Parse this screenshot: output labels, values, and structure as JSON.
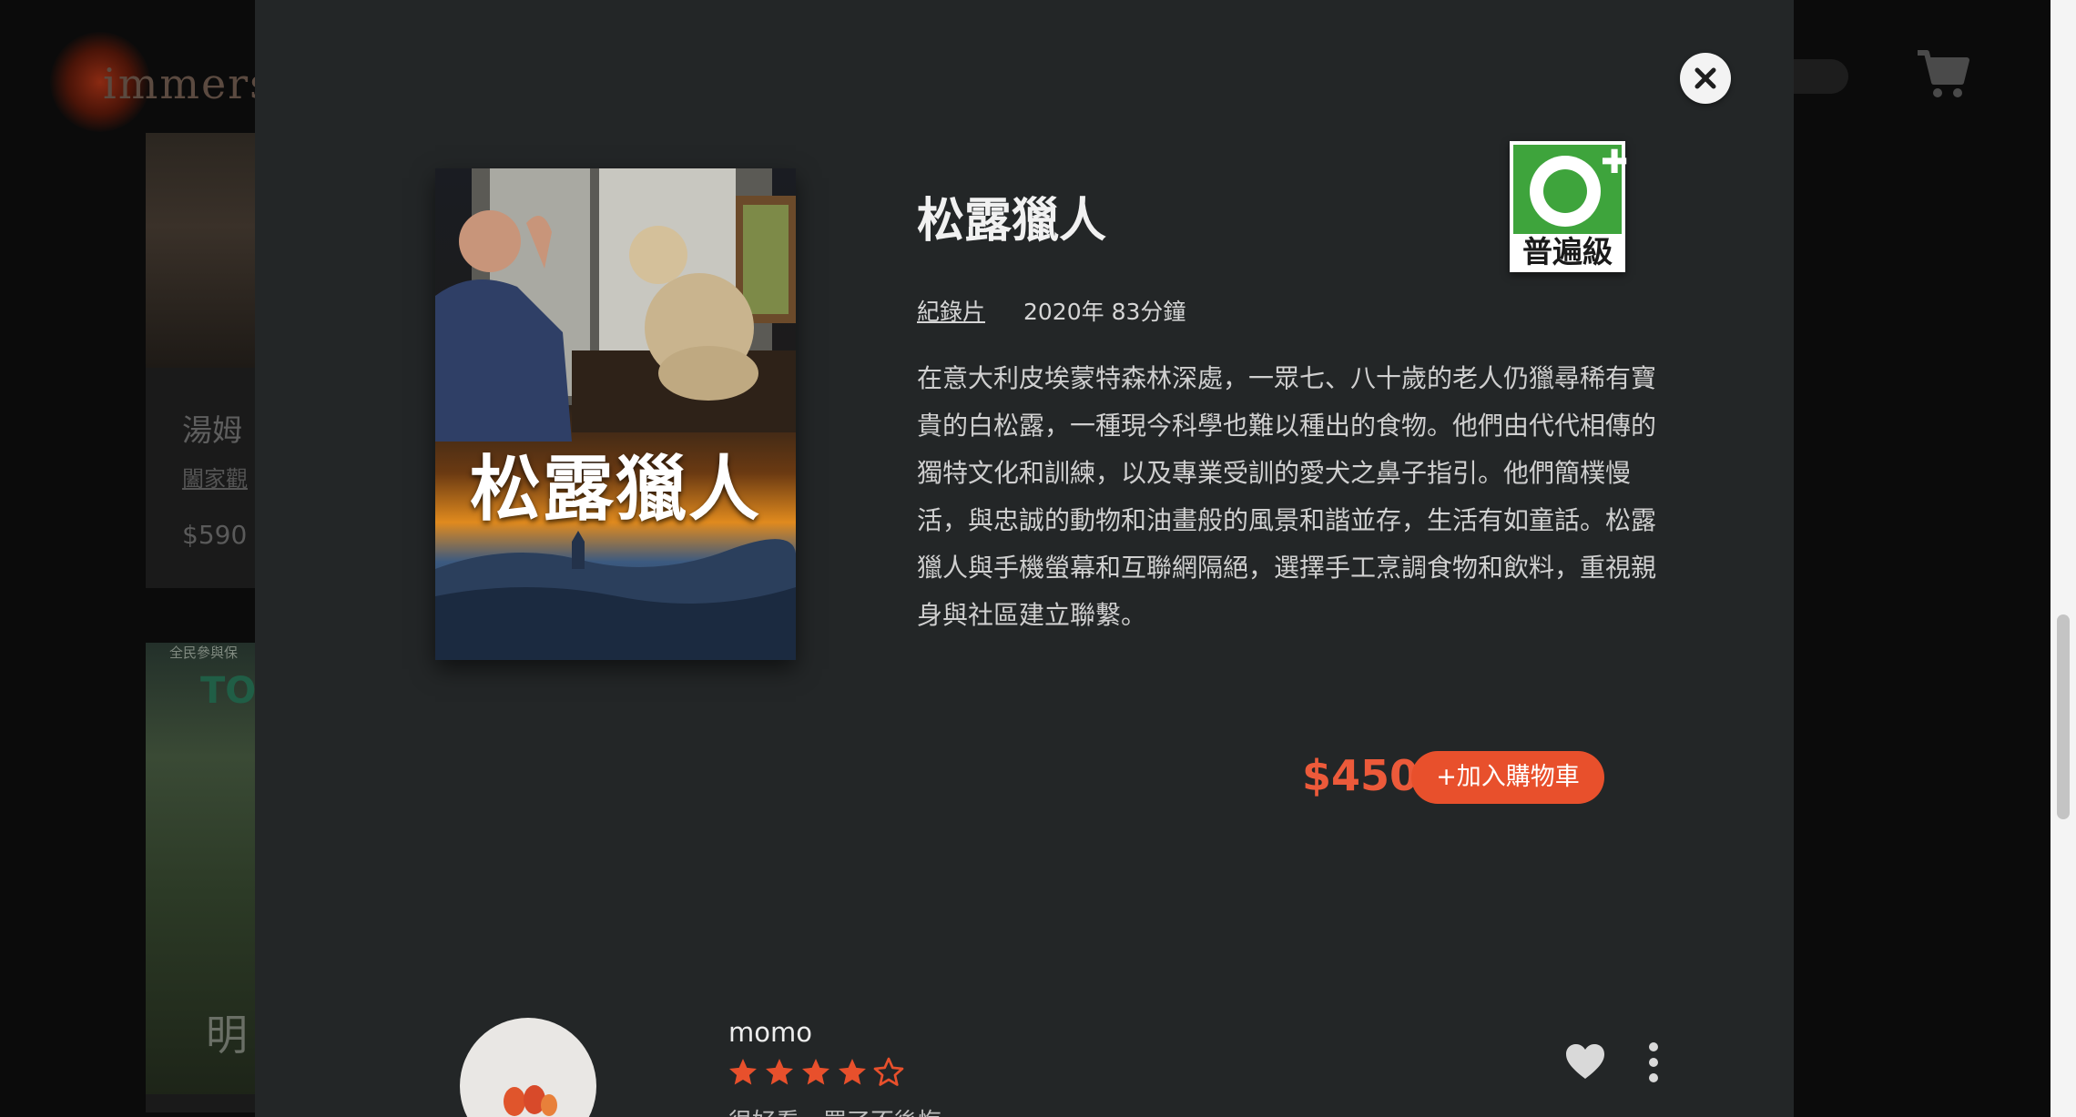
{
  "background": {
    "logo_text": "immerse",
    "card1": {
      "title": "湯姆",
      "subtitle": "闔家觀",
      "price": "$590"
    },
    "card2": {
      "tag": "全民參與保",
      "title_fragment": "TO",
      "caption": "明"
    }
  },
  "modal": {
    "close_icon": "close-icon",
    "poster_title": "松露獵人",
    "title": "松露獵人",
    "genre": "紀錄片",
    "year_duration": "2020年 83分鐘",
    "description": "在意大利皮埃蒙特森林深處，一眾七、八十歲的老人仍獵尋稀有寶貴的白松露，一種現今科學也難以種出的食物。他們由代代相傳的獨特文化和訓練，以及專業受訓的愛犬之鼻子指引。他們簡樸慢活，與忠誠的動物和油畫般的風景和諧並存，生活有如童話。松露獵人與手機螢幕和互聯網隔絕，選擇手工烹調食物和飲料，重視親身與社區建立聯繫。",
    "rating_label": "普遍級",
    "price": "$450",
    "add_to_cart_label": "+加入購物車"
  },
  "review": {
    "username": "momo",
    "rating": 4,
    "rating_max": 5,
    "text": "很好看，買了不後悔"
  },
  "colors": {
    "accent": "#e8502c",
    "price": "#ec5a3a",
    "modal_bg": "#232627",
    "rating_green": "#3ea43c"
  }
}
